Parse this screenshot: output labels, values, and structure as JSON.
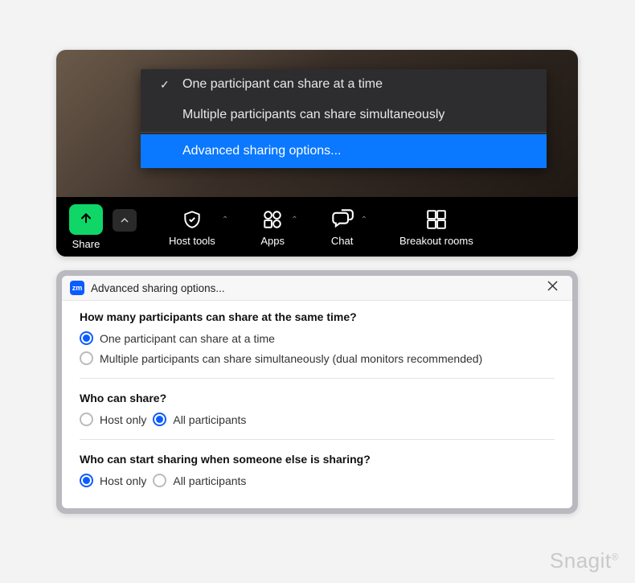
{
  "dropdown": {
    "items": [
      {
        "label": "One participant can share at a time",
        "checked": true
      },
      {
        "label": "Multiple participants can share simultaneously",
        "checked": false
      }
    ],
    "advanced_label": "Advanced sharing options..."
  },
  "toolbar": {
    "share_label": "Share",
    "host_tools_label": "Host tools",
    "apps_label": "Apps",
    "chat_label": "Chat",
    "breakout_label": "Breakout rooms"
  },
  "dialog": {
    "title": "Advanced sharing options...",
    "q1": {
      "title": "How many participants can share at the same time?",
      "opt1": "One participant can share at a time",
      "opt2": "Multiple participants can share simultaneously (dual monitors recommended)",
      "selected": "opt1"
    },
    "q2": {
      "title": "Who can share?",
      "opt1": "Host only",
      "opt2": "All participants",
      "selected": "opt2"
    },
    "q3": {
      "title": "Who can start sharing when someone else is sharing?",
      "opt1": "Host only",
      "opt2": "All participants",
      "selected": "opt1"
    }
  },
  "watermark": "Snagit"
}
